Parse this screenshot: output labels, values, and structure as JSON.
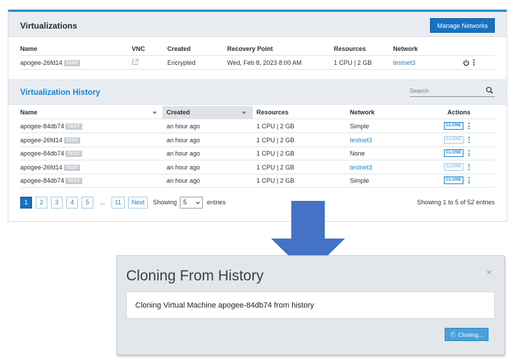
{
  "virtualizations": {
    "title": "Virtualizations",
    "manage_label": "Manage Networks",
    "columns": [
      "Name",
      "VNC",
      "Created",
      "Recovery Point",
      "Resources",
      "Network"
    ],
    "row": {
      "name": "apogee-26fd14",
      "tag": "TEST",
      "created": "Encrypted",
      "recovery_point": "Wed, Feb 8, 2023 8:00 AM",
      "resources": "1 CPU | 2 GB",
      "network": "testnet3"
    }
  },
  "history": {
    "title": "Virtualization History",
    "search_placeholder": "Search",
    "columns": [
      "Name",
      "Created",
      "Resources",
      "Network",
      "Actions"
    ],
    "clone_label": "CLONE",
    "rows": [
      {
        "name": "apogee-84db74",
        "tag": "TEST",
        "created": "an hour ago",
        "resources": "1 CPU | 2 GB",
        "network": "Simple",
        "network_link": false,
        "clone_enabled": true
      },
      {
        "name": "apogee-26fd14",
        "tag": "TEST",
        "created": "an hour ago",
        "resources": "1 CPU | 2 GB",
        "network": "testnet3",
        "network_link": true,
        "clone_enabled": false
      },
      {
        "name": "apogee-84db74",
        "tag": "TEST",
        "created": "an hour ago",
        "resources": "1 CPU | 2 GB",
        "network": "None",
        "network_link": false,
        "clone_enabled": true
      },
      {
        "name": "apogee-26fd14",
        "tag": "TEST",
        "created": "an hour ago",
        "resources": "1 CPU | 2 GB",
        "network": "testnet3",
        "network_link": true,
        "clone_enabled": false
      },
      {
        "name": "apogee-84db74",
        "tag": "TEST",
        "created": "an hour ago",
        "resources": "1 CPU | 2 GB",
        "network": "Simple",
        "network_link": false,
        "clone_enabled": true
      }
    ],
    "pagination": {
      "pages": [
        "1",
        "2",
        "3",
        "4",
        "5"
      ],
      "ellipsis": "...",
      "last": "11",
      "next": "Next",
      "active": "1",
      "showing_label": "Showing",
      "page_size": "5",
      "entries_label": "entries",
      "summary": "Showing 1 to 5 of 52 entries"
    }
  },
  "modal": {
    "title": "Cloning From History",
    "close": "×",
    "message": "Cloning Virtual Machine apogee-84db74 from history",
    "button_label": "Cloning..."
  },
  "colors": {
    "accent": "#1a84cf",
    "primary_button": "#1772c2",
    "arrow": "#4472c4",
    "modal_bg": "#e4e7ea"
  }
}
